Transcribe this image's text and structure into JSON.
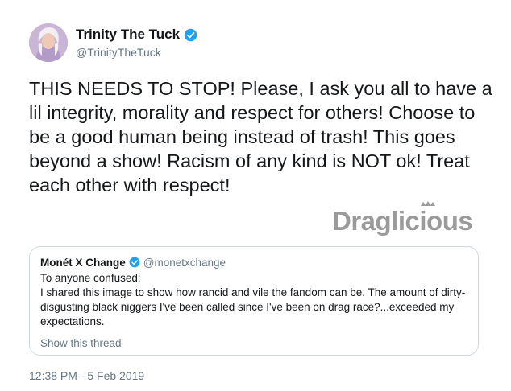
{
  "author": {
    "display_name": "Trinity The Tuck",
    "handle": "@TrinityTheTuck",
    "verified": true,
    "avatar_icon": "avatar"
  },
  "tweet": {
    "text": "THIS NEEDS TO STOP! Please, I ask you all to have a lil integrity, morality and respect for others! Choose to be a good human being instead of trash! This goes beyond a show! Racism of any kind is NOT ok! Treat each other with respect!",
    "timestamp": "12:38 PM - 5 Feb 2019"
  },
  "quoted_tweet": {
    "display_name": "Monét X Change",
    "handle": "@monetxchange",
    "verified": true,
    "line1": "To anyone confused:",
    "line2": "I shared this image to show how rancid and vile the fandom can be. The amount of dirty-disgusting black niggers I've been called since I've been on drag race?...exceeded my expectations.",
    "show_thread": "Show this thread"
  },
  "watermark": {
    "text": "Draglicious"
  },
  "colors": {
    "text": "#14171a",
    "secondary": "#657786",
    "verified": "#1da1f2",
    "border": "#ccd6dd",
    "watermark": "#9a9a9a"
  }
}
